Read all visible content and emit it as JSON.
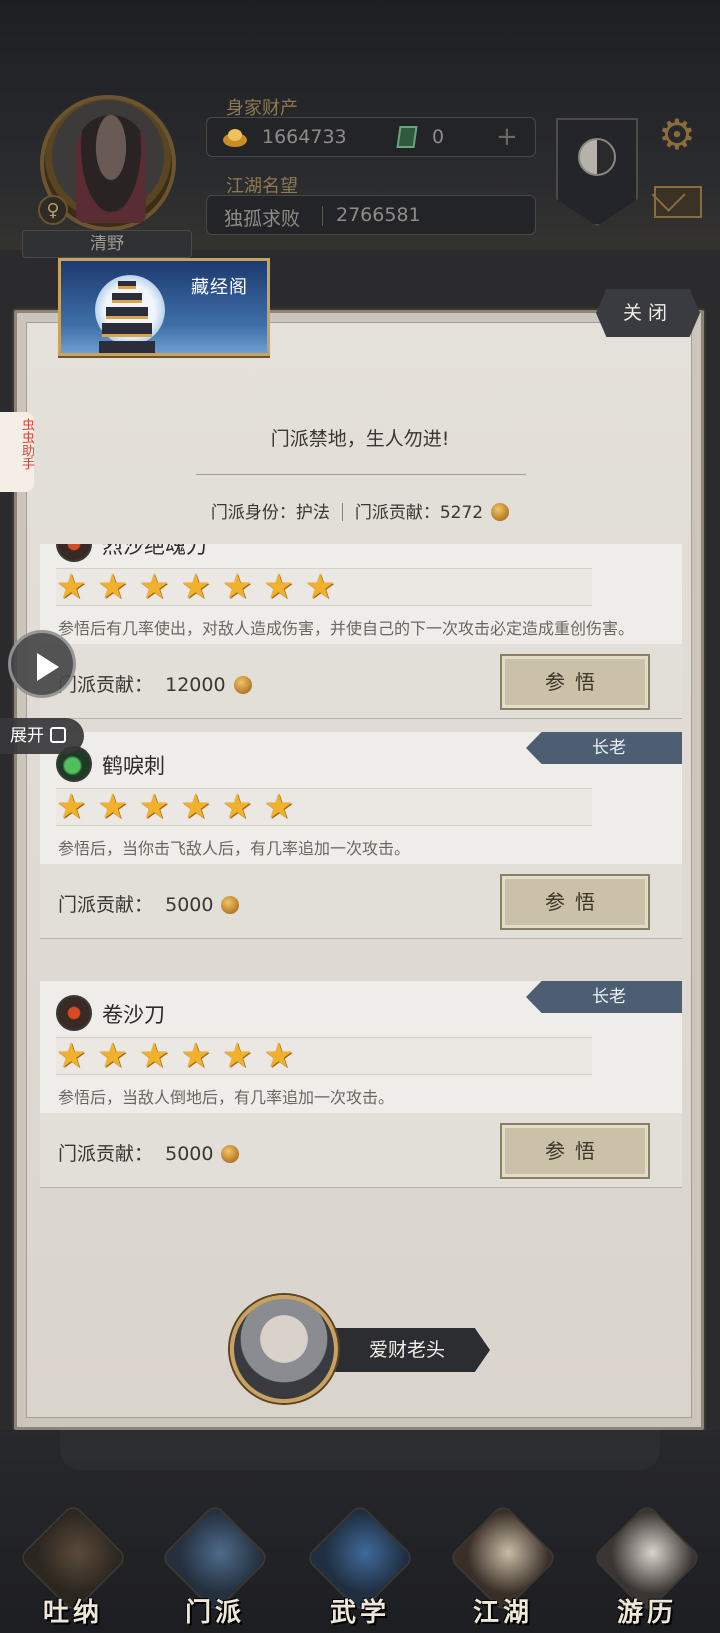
{
  "player": {
    "name": "清野",
    "gender_symbol": "♀",
    "wealth_label": "身家财产",
    "gold": "1664733",
    "jade": "0",
    "add_symbol": "+",
    "fame_label": "江湖名望",
    "fame_title": "独孤求败",
    "fame_value": "2766581"
  },
  "overlay": {
    "helper_text": "虫虫助手",
    "expand_label": "展开"
  },
  "panel": {
    "banner_title": "藏经阁",
    "close_label": "关闭",
    "motto": "门派禁地，生人勿进!",
    "identity_label": "门派身份：",
    "identity_value": "护法",
    "contribution_label": "门派贡献：",
    "contribution_value": "5272"
  },
  "skills": [
    {
      "name": "烈沙绝魂刀",
      "rank": "",
      "icon": "blade-icon",
      "stars": 7,
      "description": "参悟后有几率使出，对敌人造成伤害，并使自己的下一次攻击必定造成重创伤害。",
      "cost_label": "门派贡献：",
      "cost": "12000",
      "button": "参悟"
    },
    {
      "name": "鹤唳刺",
      "rank": "长老",
      "icon": "jade-dagger-icon",
      "stars": 6,
      "description": "参悟后，当你击飞敌人后，有几率追加一次攻击。",
      "cost_label": "门派贡献：",
      "cost": "5000",
      "button": "参悟"
    },
    {
      "name": "卷沙刀",
      "rank": "长老",
      "icon": "blade-icon",
      "stars": 6,
      "description": "参悟后，当敌人倒地后，有几率追加一次攻击。",
      "cost_label": "门派贡献：",
      "cost": "5000",
      "button": "参悟"
    }
  ],
  "npc": {
    "name": "爱财老头"
  },
  "nav": [
    {
      "label": "吐纳"
    },
    {
      "label": "门派"
    },
    {
      "label": "武学"
    },
    {
      "label": "江湖"
    },
    {
      "label": "游历"
    }
  ]
}
